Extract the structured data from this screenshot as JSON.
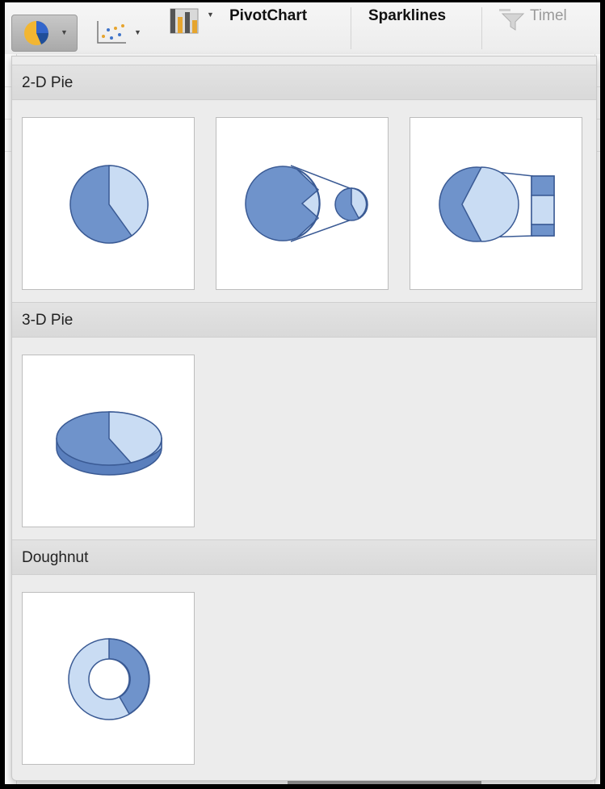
{
  "ribbon": {
    "pivotchart_label": "PivotChart",
    "sparklines_label": "Sparklines",
    "timeline_label": "Timel",
    "icons": [
      "pie-chart-icon",
      "scatter-chart-icon",
      "pivotchart-icon",
      "timeline-filter-icon"
    ]
  },
  "sections": [
    {
      "title": "2-D Pie",
      "items": [
        "pie",
        "pie-of-pie",
        "bar-of-pie"
      ]
    },
    {
      "title": "3-D Pie",
      "items": [
        "3d-pie"
      ]
    },
    {
      "title": "Doughnut",
      "items": [
        "doughnut"
      ]
    }
  ],
  "colors": {
    "dark_slice": "#6f93cb",
    "light_slice": "#c9dcf3",
    "outline": "#3a5a94"
  }
}
